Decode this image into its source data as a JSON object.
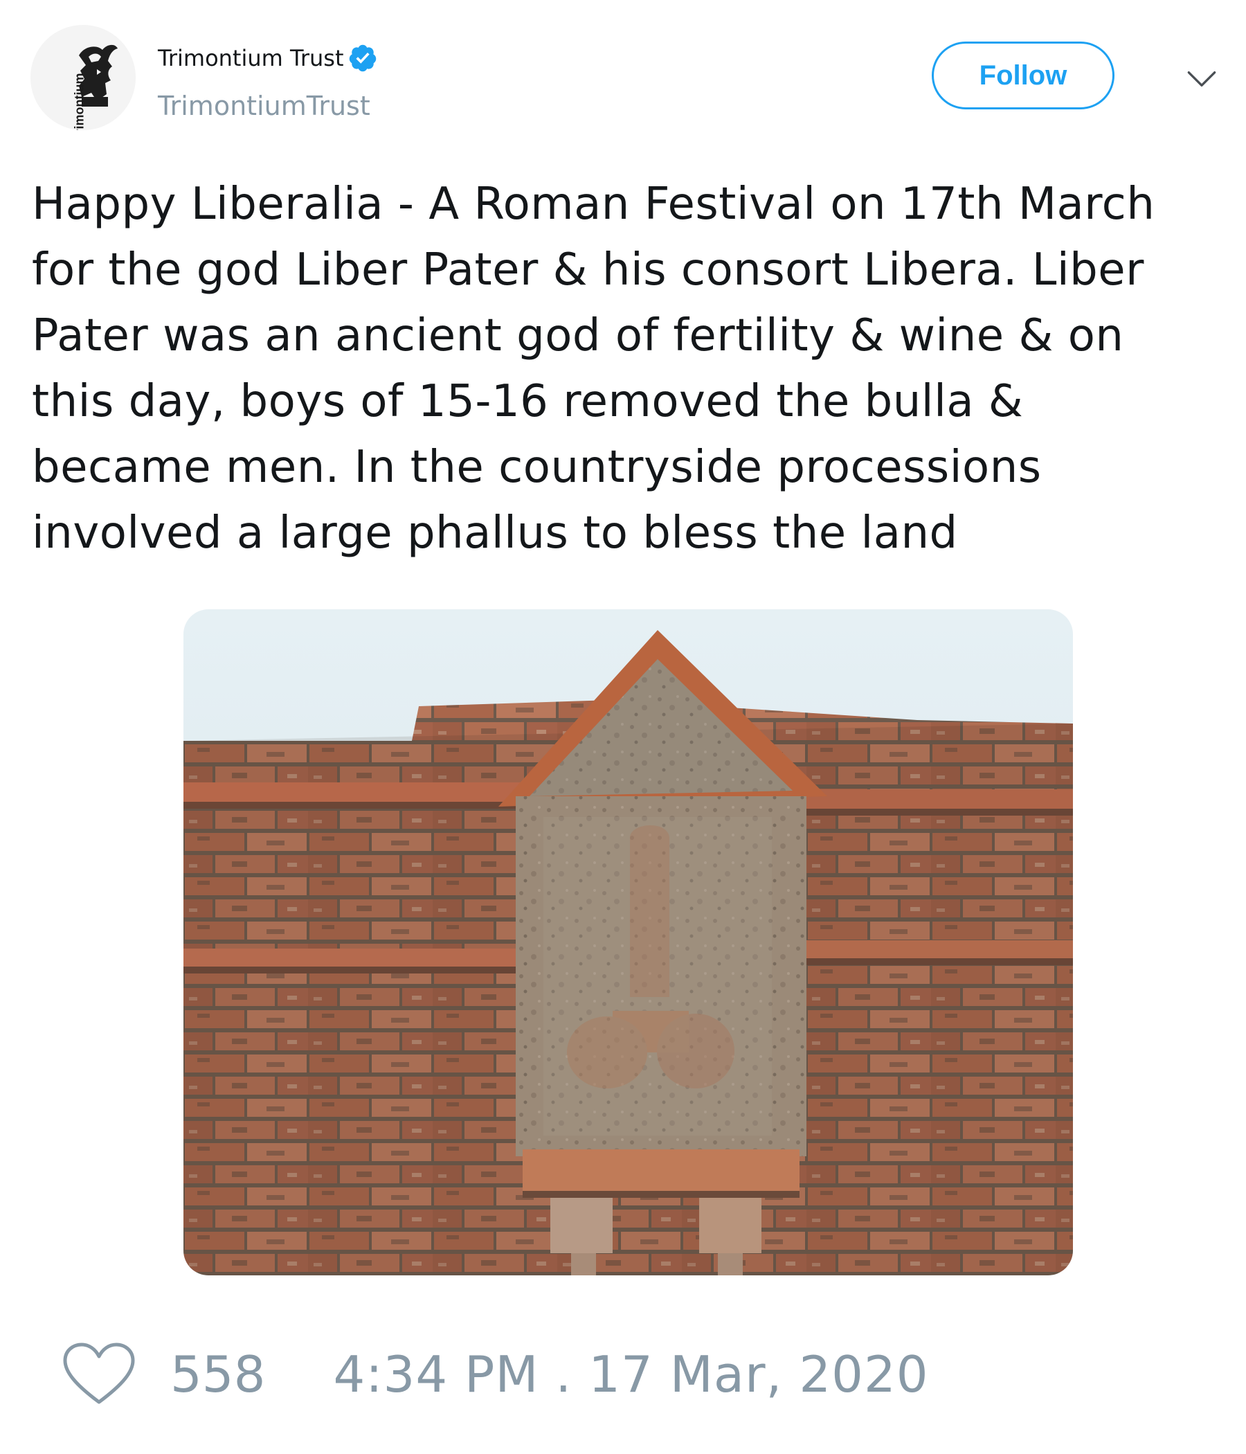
{
  "author": {
    "display_name": "Trimontium Trust",
    "handle": "TrimontiumTrust",
    "avatar_text": "Trimontium",
    "verified": true
  },
  "actions": {
    "follow_label": "Follow",
    "more_icon": "chevron-down-icon"
  },
  "tweet": {
    "text": "Happy Liberalia - A Roman Festival on 17th March\nfor the god Liber Pater & his consort Libera. Liber\nPater was an ancient god of fertility & wine & on\nthis day, boys of 15-16 removed the bulla &\nbecame men. In the countryside processions\ninvolved a large phallus to bless the land",
    "like_count": "558",
    "timestamp": "4:34 PM . 17 Mar, 2020"
  },
  "colors": {
    "accent": "#1da1f2",
    "muted": "#8899a6",
    "text": "#14171a"
  }
}
